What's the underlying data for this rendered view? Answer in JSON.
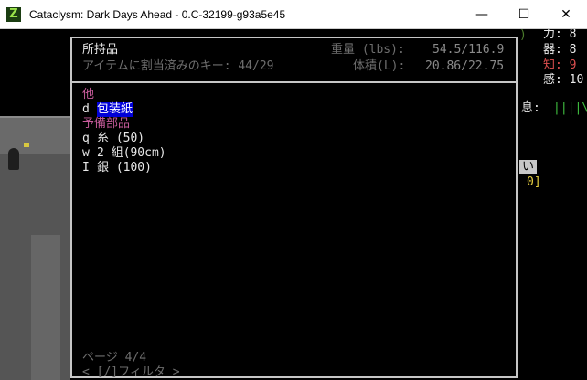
{
  "window": {
    "title": "Cataclysm: Dark Days Ahead - 0.C-32199-g93a5e45",
    "icon_glyph": "Z",
    "minimize": "—",
    "maximize": "☐",
    "close": "✕"
  },
  "colors": {
    "selected_bg": "#0000d8",
    "category": "#c85c9c",
    "border": "#c6c6c6"
  },
  "inventory": {
    "title": "所持品",
    "assigned_keys": "アイテムに割当済みのキー: 44/29",
    "weight_label": "重量 (lbs):",
    "weight_value": "54.5/116.9",
    "volume_label": "体積(L):",
    "volume_value": "20.86/22.75",
    "categories": [
      {
        "name": "他",
        "items": [
          {
            "key": "d",
            "name": "包装紙",
            "selected": true
          }
        ]
      },
      {
        "name": "予備部品",
        "items": [
          {
            "key": "q",
            "name": "糸 (50)"
          },
          {
            "key": "w",
            "name": "2 組(90cm)"
          },
          {
            "key": "I",
            "name": "銀 (100)"
          }
        ]
      }
    ],
    "page": "ページ 4/4",
    "filter_hint": "< [/]フィルタ >"
  },
  "sidebar": {
    "bracket": ")",
    "str": "力: 8",
    "dex": "器: 8",
    "int": "知: 9",
    "per": "感: 10",
    "speed_label": "息:",
    "speed_bar": "||||\\",
    "other_label": "い",
    "other_value": "0]"
  }
}
